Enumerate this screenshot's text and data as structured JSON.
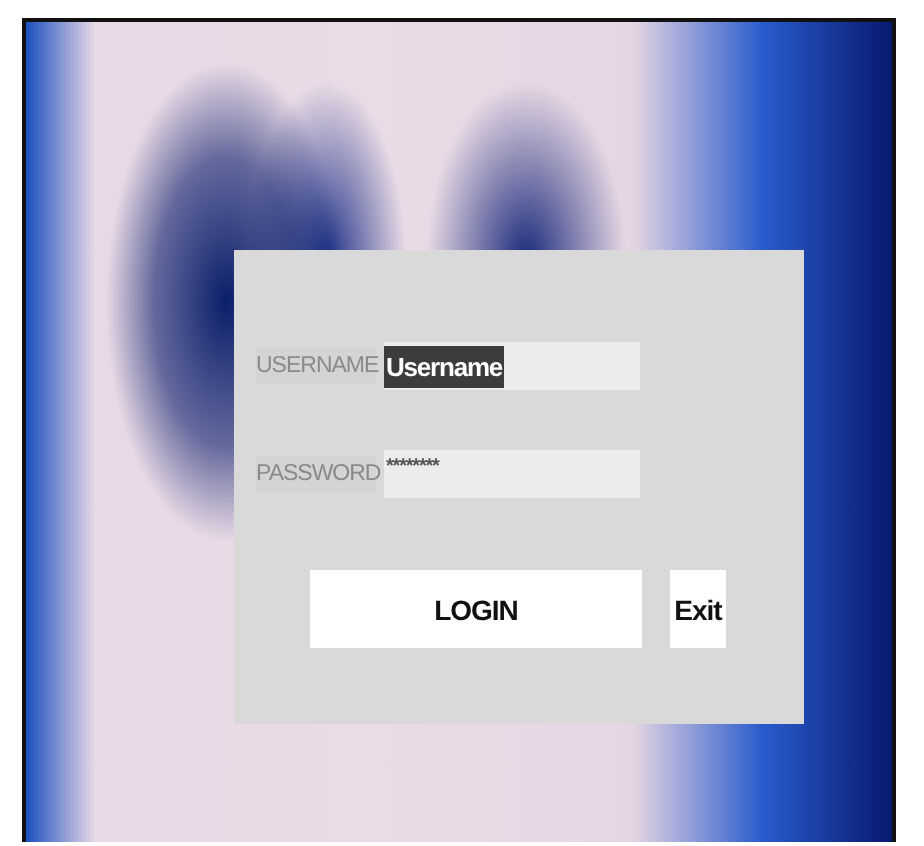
{
  "login_form": {
    "fields": [
      {
        "label": "USERNAME",
        "value": "Username",
        "text_selected": true
      },
      {
        "label": "PASSWORD",
        "value": "********",
        "text_selected": false
      }
    ],
    "buttons": [
      {
        "label": "LOGIN",
        "kind": "wide"
      },
      {
        "label": "Exit",
        "kind": "narrow"
      }
    ]
  }
}
